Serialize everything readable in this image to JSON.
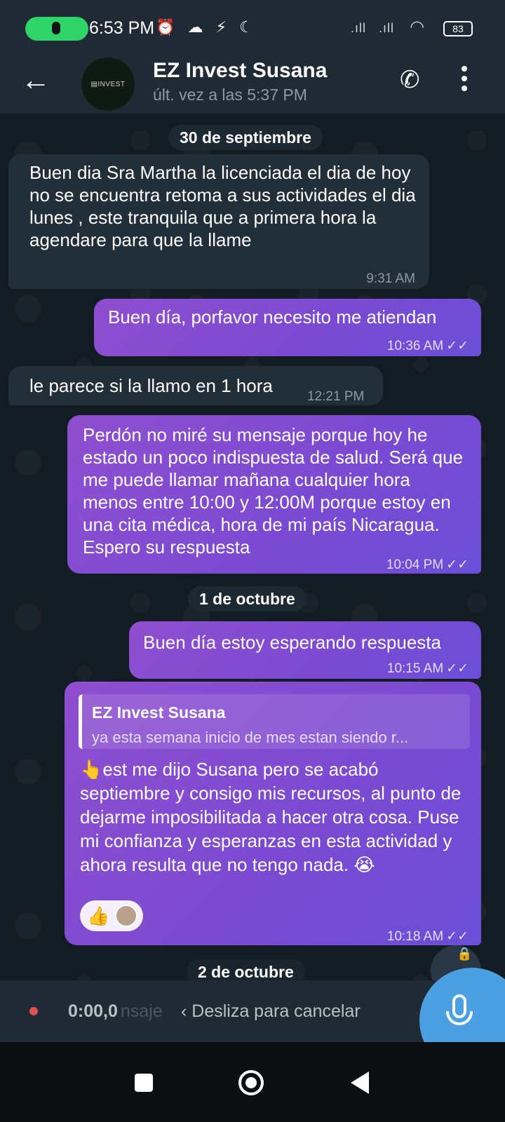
{
  "status_bar": {
    "time": "6:53 PM",
    "icons": "⏰ ☁ ⚡ ☾",
    "signal_1": ".ıll",
    "signal_2": ".ıll",
    "battery": "83"
  },
  "header": {
    "contact_name": "EZ Invest Susana",
    "last_seen": "últ. vez a las 5:37 PM",
    "avatar_text": "▤INVEST"
  },
  "dates": {
    "d1": "30 de septiembre",
    "d2": "1 de octubre",
    "d3": "2 de octubre"
  },
  "messages": [
    {
      "direction": "in",
      "text": "Buen dia Sra Martha la licenciada el dia de hoy no se encuentra retoma a sus actividades el dia lunes , este tranquila que a primera hora la agendare para que la llame",
      "time": "9:31 AM"
    },
    {
      "direction": "out",
      "text": "Buen día, porfavor necesito me atiendan",
      "time": "10:36 AM"
    },
    {
      "direction": "in",
      "text": "le parece si la llamo en 1 hora",
      "time": "12:21 PM"
    },
    {
      "direction": "out",
      "text": "Perdón no miré su mensaje porque hoy he estado un poco indispuesta de salud. Será que me puede llamar mañana cualquier hora menos entre 10:00 y 12:00M porque estoy en una cita médica, hora de mi país Nicaragua. Espero su respuesta",
      "time": "10:04 PM"
    },
    {
      "direction": "out",
      "text": "Buen día estoy esperando respuesta",
      "time": "10:15 AM"
    },
    {
      "direction": "out",
      "quote_name": "EZ Invest Susana",
      "quote_text": "ya esta semana inicio de mes estan siendo r...",
      "text": "👆est me dijo Susana pero se acabó septiembre y consigo mis recursos, al punto de dejarme imposibilitada a hacer otra cosa. Puse mi confianza y esperanzas en esta actividad y ahora resulta que no tengo nada. 😭",
      "reaction": "👍",
      "time": "10:18 AM"
    }
  ],
  "ticks": "✓✓",
  "recorder": {
    "elapsed": "0:00,0",
    "ghost_placeholder": "nsaje",
    "slide_hint": "‹ Desliza para cancelar"
  }
}
